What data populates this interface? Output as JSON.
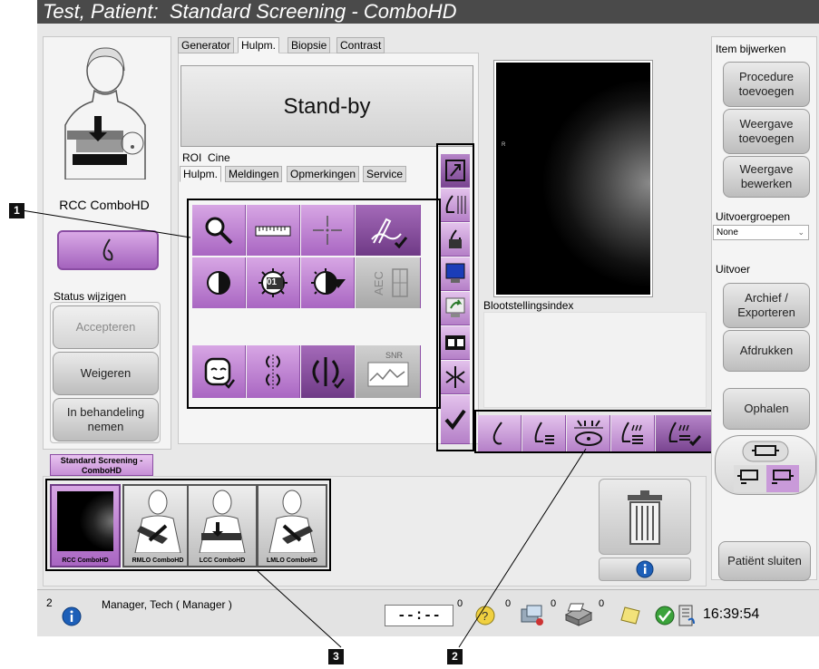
{
  "window": {
    "title": "Test, Patient:  Standard Screening - ComboHD"
  },
  "patient_view": {
    "label": "RCC ComboHD",
    "status_header": "Status wijzigen",
    "accept": "Accepteren",
    "reject": "Weigeren",
    "pending": "In behandeling nemen"
  },
  "tabs_top": [
    "Generator",
    "Hulpm.",
    "Biopsie",
    "Contrast"
  ],
  "standby_text": "Stand-by",
  "subtabs_row1": [
    "ROI",
    "Cine"
  ],
  "subtabs_row2": [
    "Hulpm.",
    "Meldingen",
    "Opmerkingen",
    "Service"
  ],
  "tools": {
    "magnifier_badge": "01",
    "aec_label": "AEC",
    "snr_label": "SNR"
  },
  "image": {
    "marker": "R",
    "exposure_label": "Blootstellingsindex"
  },
  "right_panel": {
    "item_update_header": "Item bijwerken",
    "add_procedure": "Procedure toevoegen",
    "add_view": "Weergave toevoegen",
    "edit_view": "Weergave bewerken",
    "output_groups_header": "Uitvoergroepen",
    "output_groups_value": "None",
    "output_header": "Uitvoer",
    "archive_export": "Archief / Exporteren",
    "print": "Afdrukken",
    "retrieve": "Ophalen",
    "close_patient": "Patiënt sluiten"
  },
  "procedure_tab": "Standard Screening - ComboHD",
  "thumbnails": [
    "RCC ComboHD",
    "RMLO ComboHD",
    "LCC ComboHD",
    "LMLO ComboHD"
  ],
  "status_bar": {
    "alerts_count": "2",
    "user": "Manager, Tech ( Manager )",
    "timer": "--:--",
    "count_help": "0",
    "count_queue": "0",
    "count_print": "0",
    "count_archive": "0",
    "count_timer": "0",
    "time": "16:39:54"
  },
  "callouts": [
    "1",
    "2",
    "3"
  ],
  "colors": {
    "accent_purple": "#a966c2",
    "title_bar": "#4a4a4a",
    "highlight_border": "#000000"
  }
}
